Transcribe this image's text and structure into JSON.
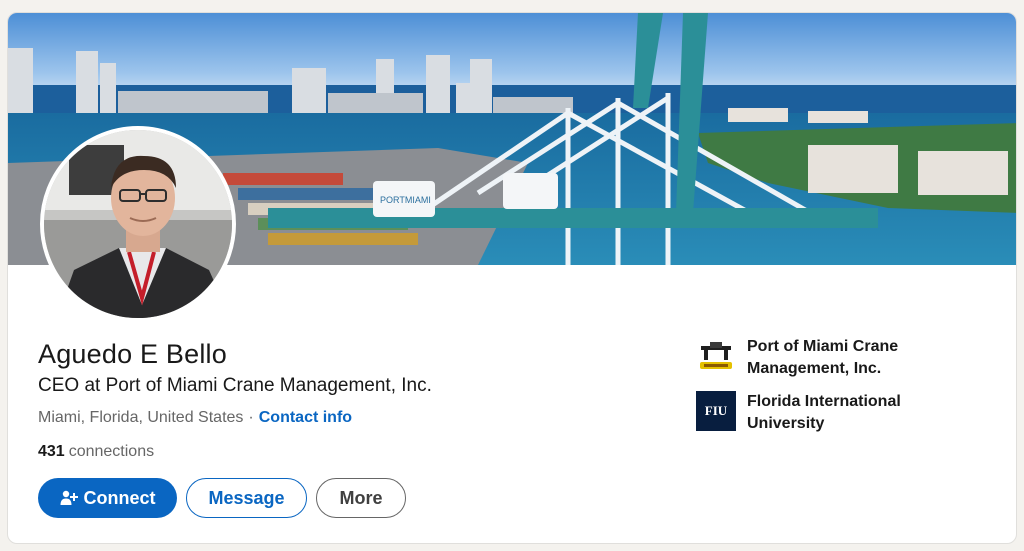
{
  "profile": {
    "name": "Aguedo E Bello",
    "headline": "CEO at Port of Miami Crane Management, Inc.",
    "location": "Miami, Florida, United States",
    "separator": "·",
    "contact_info": "Contact info",
    "connections_count": "431",
    "connections_label": "connections"
  },
  "actions": {
    "connect_label": "Connect",
    "message_label": "Message",
    "more_label": "More"
  },
  "orgs": [
    {
      "name_line1": "Port of Miami Crane",
      "name_line2": "Management, Inc.",
      "logo_icon": "crane-company-logo"
    },
    {
      "name_line1": "Florida International",
      "name_line2": "University",
      "logo_text": "FIU",
      "logo_icon": "fiu-logo"
    }
  ],
  "banner": {
    "crane_label": "PORTMIAMI"
  },
  "colors": {
    "accent": "#0a66c2",
    "page_bg": "#f4f2ee",
    "card_bg": "#ffffff",
    "fiu_navy": "#081e3f"
  }
}
